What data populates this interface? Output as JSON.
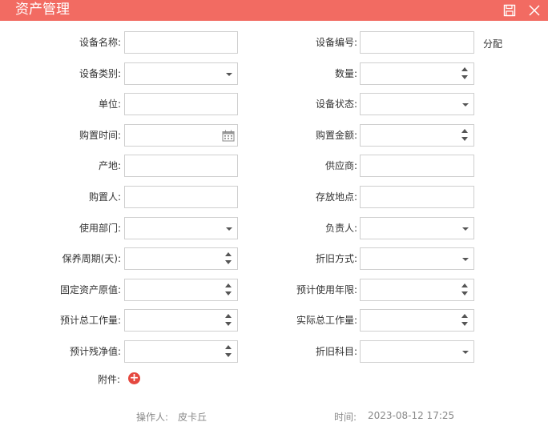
{
  "header": {
    "title": "资产管理"
  },
  "left_fields": [
    {
      "label": "设备名称:",
      "type": "text",
      "value": ""
    },
    {
      "label": "设备类别:",
      "type": "select",
      "value": ""
    },
    {
      "label": "单位:",
      "type": "text",
      "value": ""
    },
    {
      "label": "购置时间:",
      "type": "date",
      "value": ""
    },
    {
      "label": "产地:",
      "type": "text",
      "value": ""
    },
    {
      "label": "购置人:",
      "type": "text",
      "value": ""
    },
    {
      "label": "使用部门:",
      "type": "select",
      "value": ""
    },
    {
      "label": "保养周期(天):",
      "type": "number",
      "value": ""
    },
    {
      "label": "固定资产原值:",
      "type": "number",
      "value": ""
    },
    {
      "label": "预计总工作量:",
      "type": "number",
      "value": ""
    },
    {
      "label": "预计残净值:",
      "type": "number",
      "value": ""
    }
  ],
  "right_fields": [
    {
      "label": "设备编号:",
      "type": "text",
      "value": ""
    },
    {
      "label": "数量:",
      "type": "number",
      "value": ""
    },
    {
      "label": "设备状态:",
      "type": "select",
      "value": ""
    },
    {
      "label": "购置金额:",
      "type": "number",
      "value": ""
    },
    {
      "label": "供应商:",
      "type": "text",
      "value": ""
    },
    {
      "label": "存放地点:",
      "type": "text",
      "value": ""
    },
    {
      "label": "负责人:",
      "type": "select",
      "value": ""
    },
    {
      "label": "折旧方式:",
      "type": "select",
      "value": ""
    },
    {
      "label": "预计使用年限:",
      "type": "number",
      "value": ""
    },
    {
      "label": "实际总工作量:",
      "type": "number",
      "value": ""
    },
    {
      "label": "折旧科目:",
      "type": "select",
      "value": ""
    }
  ],
  "assign_link": "分配",
  "attachment": {
    "label": "附件:",
    "add_icon": "plus-circle-icon"
  },
  "footer": {
    "operator_label": "操作人:",
    "operator": "皮卡丘",
    "time_label": "时间:",
    "time": "2023-08-12 17:25"
  },
  "colors": {
    "title_bar": "#f26b62",
    "add_button": "#e5483f"
  }
}
